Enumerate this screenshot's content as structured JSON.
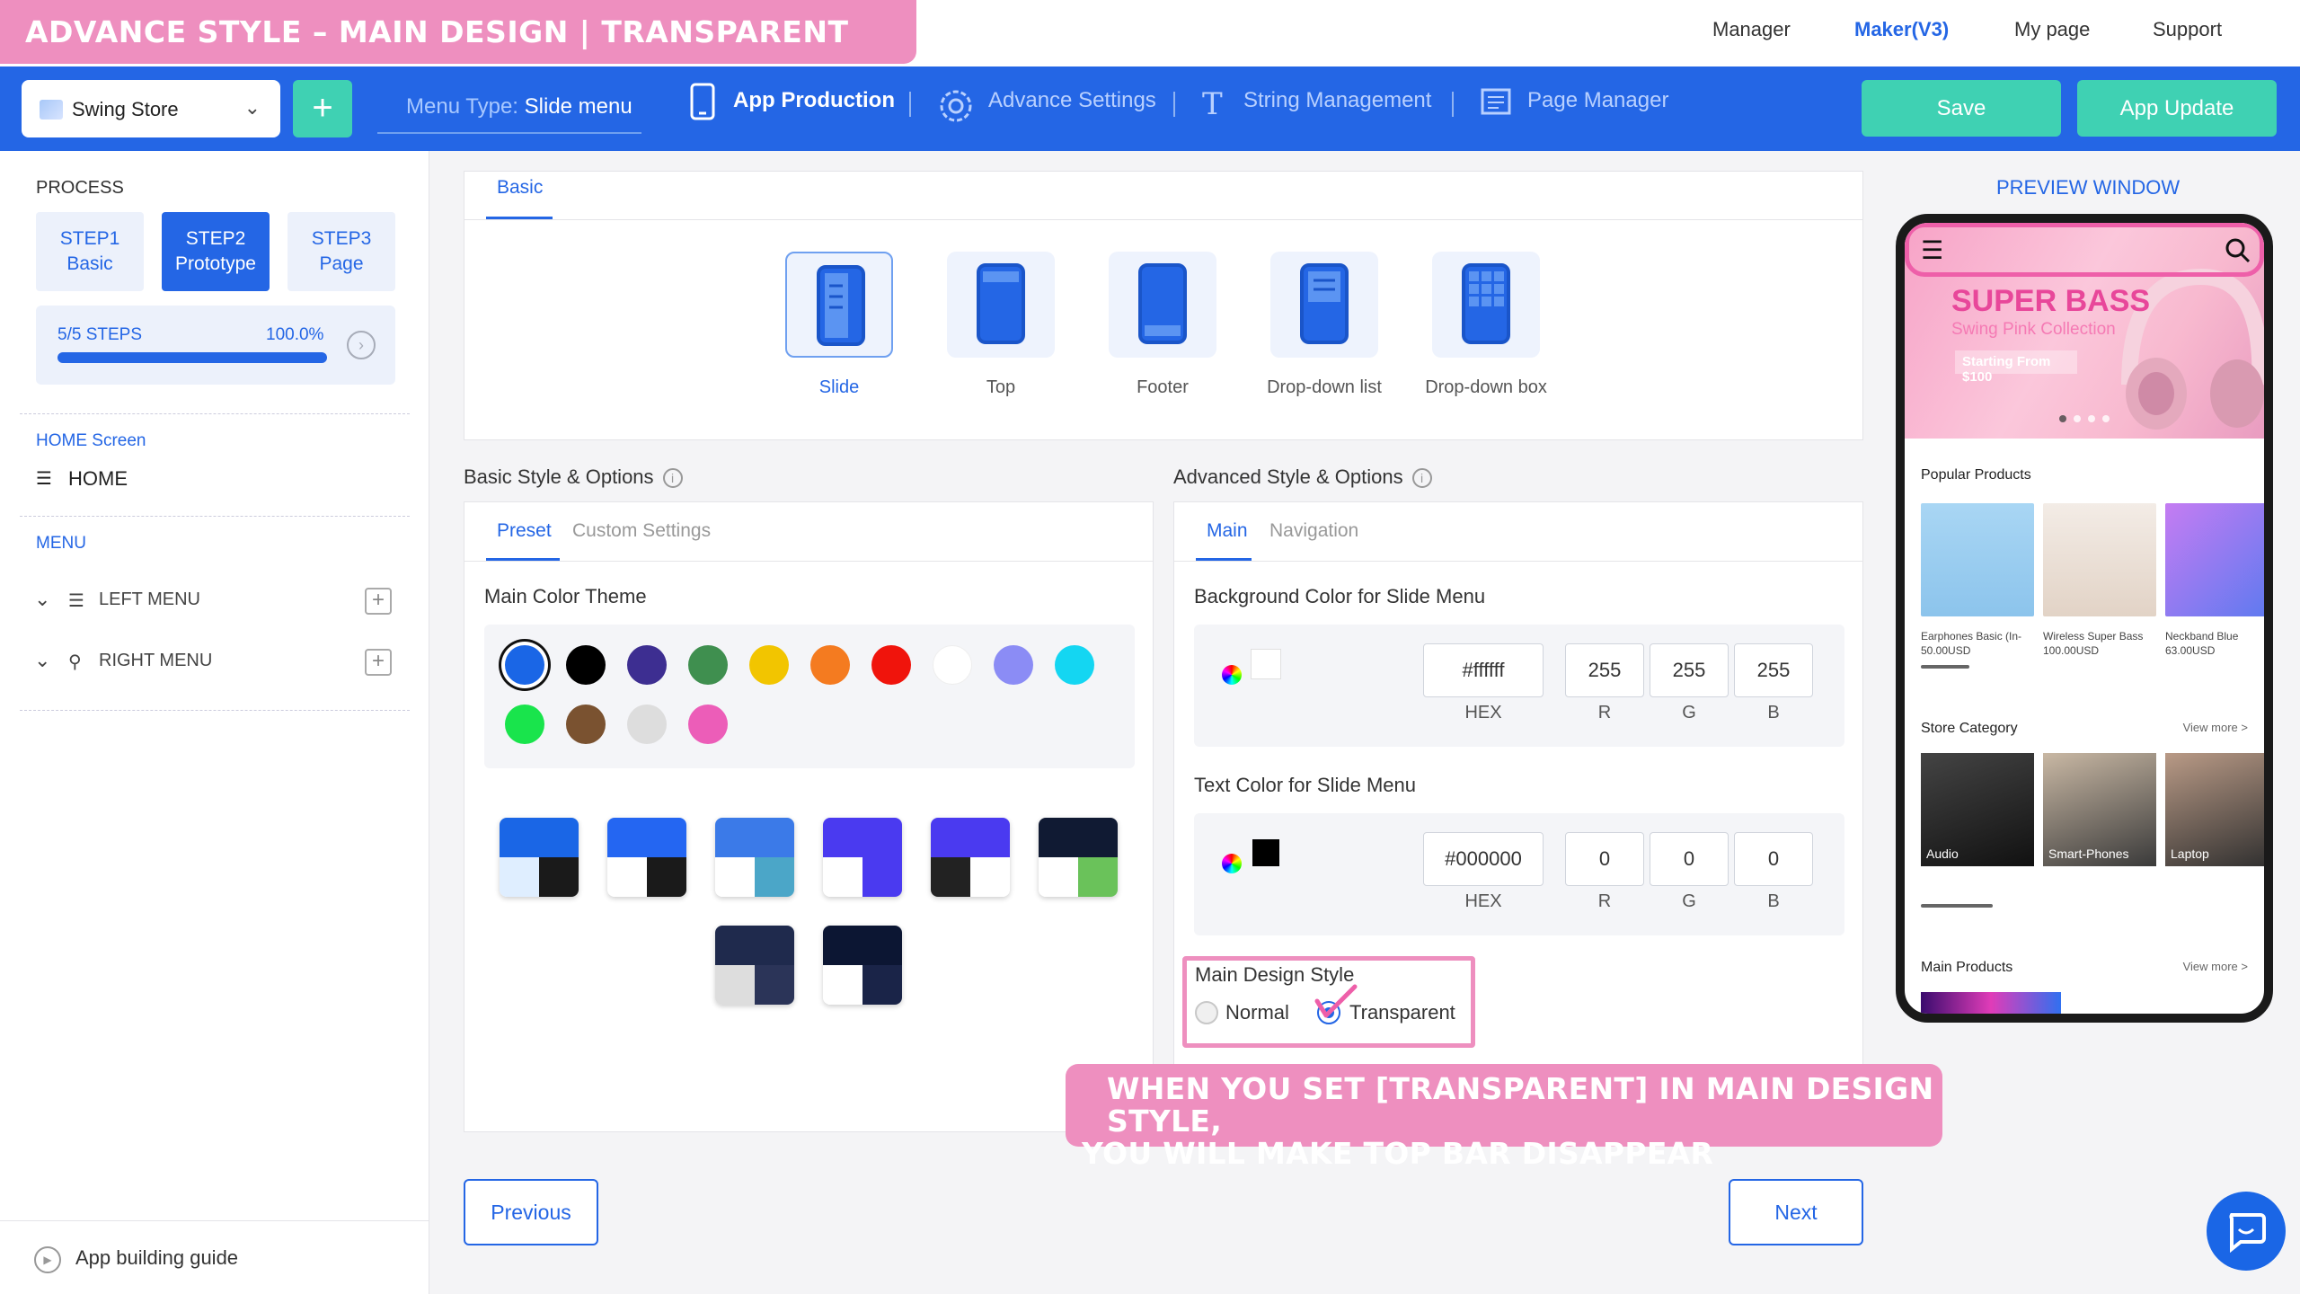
{
  "banner": "ADVANCE STYLE – MAIN DESIGN | TRANSPARENT SETTING",
  "topnav": [
    "Manager",
    "Maker(V3)",
    "My page",
    "Support"
  ],
  "header": {
    "store": "Swing Store",
    "menu_type_key": "Menu Type:",
    "menu_type_value": "Slide menu",
    "nav": [
      "App Production",
      "Advance Settings",
      "String Management",
      "Page Manager"
    ],
    "save": "Save",
    "update": "App Update"
  },
  "sidebar": {
    "process": "PROCESS",
    "steps": [
      {
        "l1": "STEP1",
        "l2": "Basic"
      },
      {
        "l1": "STEP2",
        "l2": "Prototype"
      },
      {
        "l1": "STEP3",
        "l2": "Page"
      }
    ],
    "progress_label": "5/5 STEPS",
    "progress_pct": "100.0%",
    "progress_value": 1.0,
    "home_section": "HOME Screen",
    "home_item": "HOME",
    "menu_section": "MENU",
    "left_menu": "LEFT MENU",
    "right_menu": "RIGHT MENU",
    "guide": "App building guide"
  },
  "basic_tab": "Basic",
  "menu_types": [
    "Slide",
    "Top",
    "Footer",
    "Drop-down list",
    "Drop-down box"
  ],
  "basic_style": {
    "title": "Basic Style & Options",
    "tabs": [
      "Preset",
      "Custom Settings"
    ],
    "color_theme": "Main Color Theme",
    "colors": [
      "#1a66e6",
      "#000000",
      "#3d2e91",
      "#3f8f4f",
      "#f2c500",
      "#f47b20",
      "#f0140c",
      "#ffffff",
      "#8b8cf5",
      "#14d6f2",
      "#19e44c",
      "#7a5230",
      "#dddddd",
      "#ec5db8"
    ]
  },
  "advanced_style": {
    "title": "Advanced Style & Options",
    "tabs": [
      "Main",
      "Navigation"
    ],
    "bg_title": "Background Color for Slide Menu",
    "bg_hex": "#ffffff",
    "bg_r": "255",
    "bg_g": "255",
    "bg_b": "255",
    "text_title": "Text Color for Slide Menu",
    "text_hex": "#000000",
    "text_r": "0",
    "text_g": "0",
    "text_b": "0",
    "labels": [
      "HEX",
      "R",
      "G",
      "B"
    ],
    "design_title": "Main Design Style",
    "normal": "Normal",
    "transparent": "Transparent"
  },
  "buttons": {
    "previous": "Previous",
    "next": "Next"
  },
  "callout": [
    "WHEN YOU SET [TRANSPARENT] IN MAIN DESIGN STYLE,",
    "YOU WILL MAKE TOP BAR DISAPPEAR"
  ],
  "preview": {
    "title": "PREVIEW WINDOW",
    "hero_title": "SUPER BASS",
    "hero_sub": "Swing Pink Collection",
    "hero_price": "Starting From $100",
    "popular": "Popular Products",
    "products": [
      {
        "name": "Earphones Basic (In-",
        "price": "50.00USD"
      },
      {
        "name": "Wireless Super Bass",
        "price": "100.00USD"
      },
      {
        "name": "Neckband Blue",
        "price": "63.00USD"
      }
    ],
    "category": "Store Category",
    "view_more": "View more >",
    "categories": [
      "Audio",
      "Smart-Phones",
      "Laptop"
    ],
    "main_products": "Main Products"
  }
}
